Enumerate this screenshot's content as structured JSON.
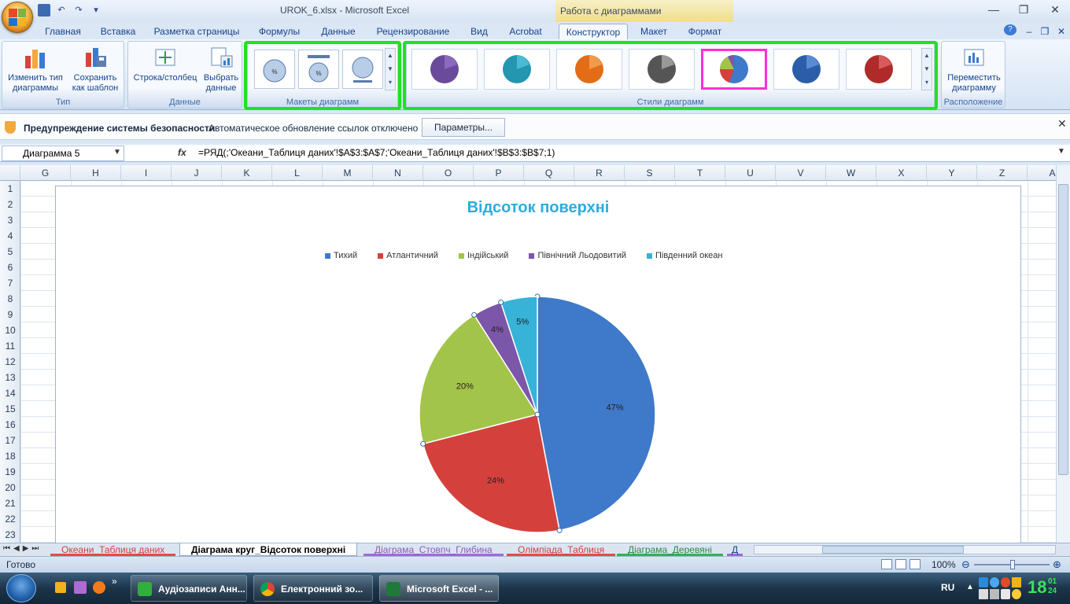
{
  "window": {
    "title": "UROK_6.xlsx - Microsoft Excel",
    "context_title": "Работа с диаграммами"
  },
  "tabs": [
    "Главная",
    "Вставка",
    "Разметка страницы",
    "Формулы",
    "Данные",
    "Рецензирование",
    "Вид",
    "Acrobat",
    "Конструктор",
    "Макет",
    "Формат"
  ],
  "ribbon": {
    "type_group": {
      "label": "Тип",
      "change_type": "Изменить тип диаграммы",
      "save_template": "Сохранить как шаблон"
    },
    "data_group": {
      "label": "Данные",
      "row_col": "Строка/столбец",
      "select_data": "Выбрать данные"
    },
    "layouts_group": {
      "label": "Макеты диаграмм"
    },
    "styles_group": {
      "label": "Стили диаграмм"
    },
    "location_group": {
      "label": "Расположение",
      "move_chart": "Переместить диаграмму"
    }
  },
  "security_bar": {
    "title": "Предупреждение системы безопасности",
    "message": "Автоматическое обновление ссылок отключено",
    "button": "Параметры..."
  },
  "formula_bar": {
    "name_box": "Диаграмма 5",
    "fx": "fx",
    "formula": "=РЯД(;'Океани_Таблиця даних'!$A$3:$A$7;'Океани_Таблиця даних'!$B$3:$B$7;1)"
  },
  "columns": [
    "G",
    "H",
    "I",
    "J",
    "K",
    "L",
    "M",
    "N",
    "O",
    "P",
    "Q",
    "R",
    "S",
    "T",
    "U",
    "V",
    "W",
    "X",
    "Y",
    "Z",
    "A"
  ],
  "rows": [
    "1",
    "2",
    "3",
    "4",
    "5",
    "6",
    "7",
    "8",
    "9",
    "10",
    "11",
    "12",
    "13",
    "14",
    "15",
    "16",
    "17",
    "18",
    "19",
    "20",
    "21",
    "22",
    "23"
  ],
  "chart_data": {
    "type": "pie",
    "title": "Відсоток поверхні",
    "categories": [
      "Тихий",
      "Атлантичний",
      "Індійський",
      "Північний Льодовитий",
      "Південний океан"
    ],
    "values": [
      47,
      24,
      20,
      4,
      5
    ],
    "labels": [
      "47%",
      "24%",
      "20%",
      "4%",
      "5%"
    ],
    "colors": [
      "#3f79c9",
      "#d4413c",
      "#a3c44a",
      "#7c56a8",
      "#37b3d8"
    ],
    "legend": "top"
  },
  "sheet_tabs": [
    "Океани_Таблиця даних",
    "Діаграма круг_Відсоток поверхні",
    "Діаграма_Стовпч_Глибина",
    "Олімпіада_Таблиця",
    "Діаграма_Деревяні",
    "Д"
  ],
  "status": {
    "ready": "Готово",
    "zoom": "100%"
  },
  "taskbar": {
    "items": [
      "Аудіозаписи Анн...",
      "Електронний зо...",
      "Microsoft Excel - ..."
    ],
    "lang": "RU",
    "time_h": "18",
    "time_m": "01",
    "time_s": "24"
  }
}
